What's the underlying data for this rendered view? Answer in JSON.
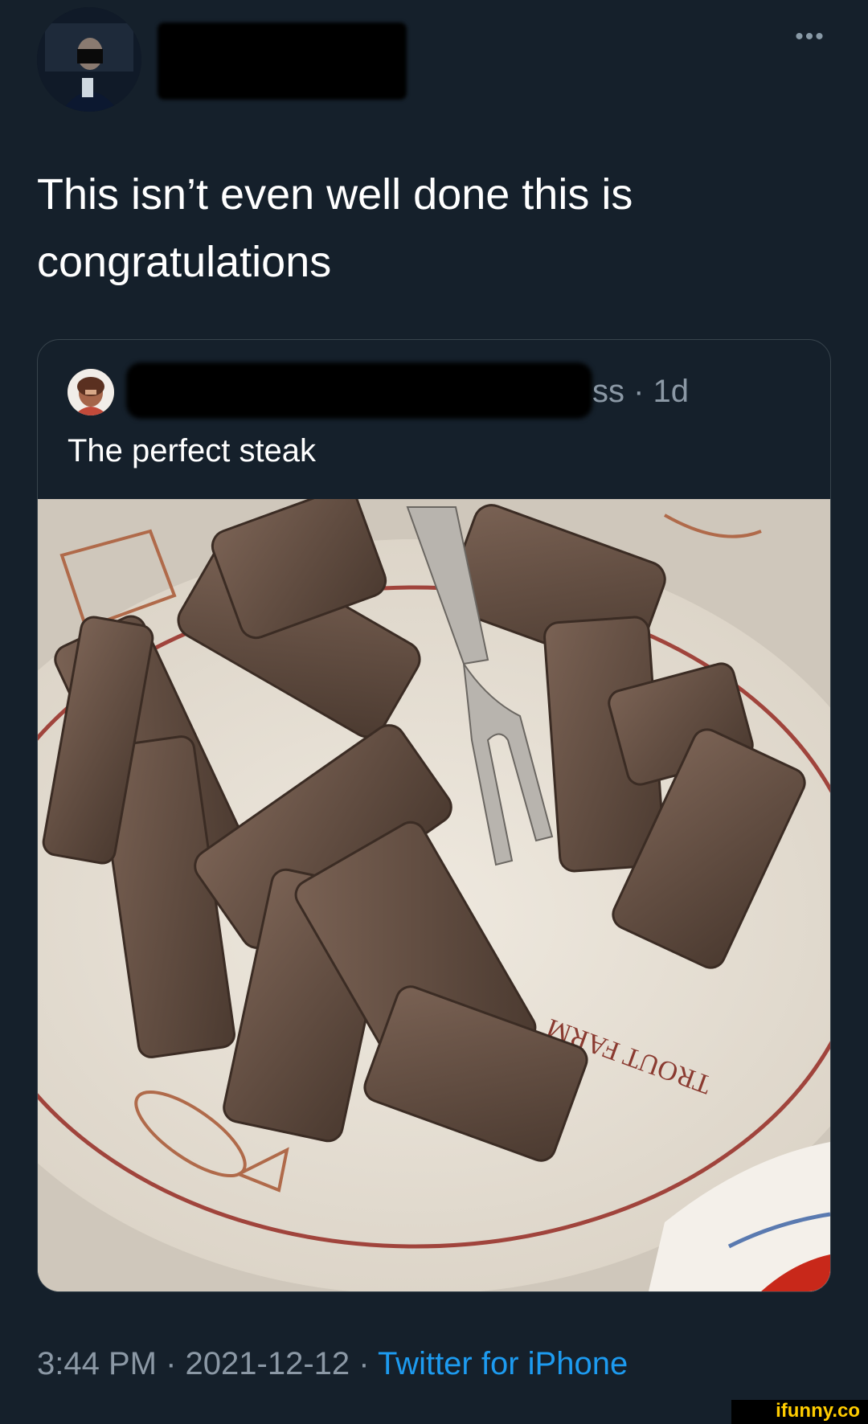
{
  "tweet": {
    "text_line1": "This isn’t even well done this is",
    "text_line2": "congratulations",
    "more_glyph": "•••"
  },
  "quoted": {
    "meta": "ss · 1d",
    "text": "The perfect steak",
    "image_plate_text": "TROUT FARM"
  },
  "footer": {
    "time": "3:44 PM",
    "date": "2021-12-12",
    "separator": " · ",
    "source": "Twitter for iPhone"
  },
  "watermark": "ifunny.co",
  "colors": {
    "background": "#15202b",
    "muted_text": "#8b98a5",
    "link": "#1d9bf0",
    "watermark": "#ffcc00"
  }
}
